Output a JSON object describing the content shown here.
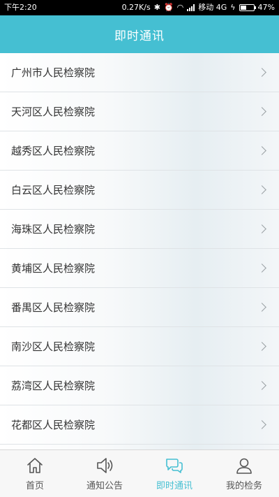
{
  "status_bar": {
    "time": "下午2:20",
    "network_speed": "0.27K/s",
    "carrier": "移动 4G",
    "battery": "47%",
    "battery_level": 0.47,
    "icons": [
      "bluetooth-icon",
      "alarm-icon",
      "wifi-icon",
      "signal-icon",
      "charging-icon"
    ]
  },
  "header": {
    "title": "即时通讯"
  },
  "list": {
    "items": [
      {
        "label": "广州市人民检察院"
      },
      {
        "label": "天河区人民检察院"
      },
      {
        "label": "越秀区人民检察院"
      },
      {
        "label": "白云区人民检察院"
      },
      {
        "label": "海珠区人民检察院"
      },
      {
        "label": "黄埔区人民检察院"
      },
      {
        "label": "番禺区人民检察院"
      },
      {
        "label": "南沙区人民检察院"
      },
      {
        "label": "荔湾区人民检察院"
      },
      {
        "label": "花都区人民检察院"
      }
    ]
  },
  "tab_bar": {
    "tabs": [
      {
        "label": "首页",
        "icon": "home-icon",
        "active": false
      },
      {
        "label": "通知公告",
        "icon": "speaker-icon",
        "active": false
      },
      {
        "label": "即时通讯",
        "icon": "chat-bubbles-icon",
        "active": true
      },
      {
        "label": "我的检务",
        "icon": "user-icon",
        "active": false
      }
    ]
  },
  "colors": {
    "accent": "#45bfd2",
    "tab_inactive": "#555555",
    "list_text": "#333333"
  }
}
